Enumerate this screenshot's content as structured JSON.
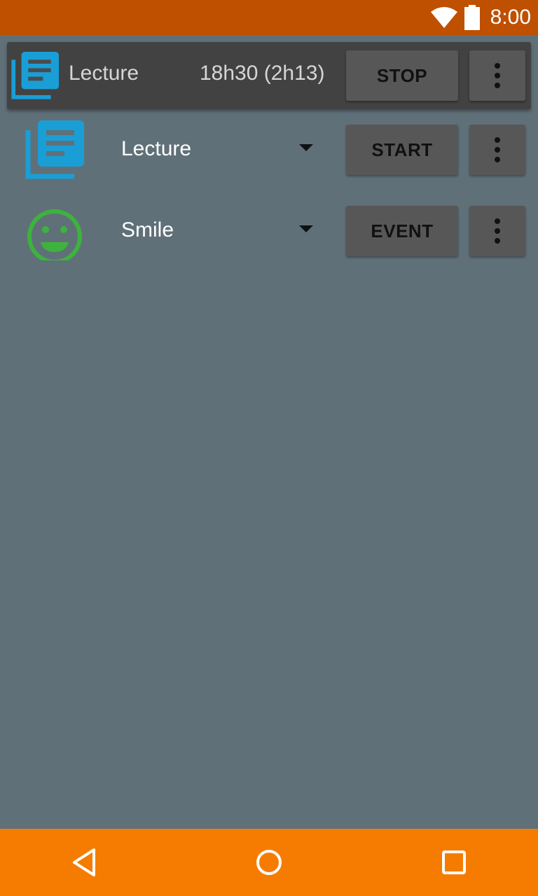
{
  "status_bar": {
    "time": "8:00",
    "icons": [
      "wifi-icon",
      "battery-icon"
    ]
  },
  "active": {
    "icon": "document-stack-icon",
    "name": "Lecture",
    "time": "18h30 (2h13)",
    "stop_label": "STOP",
    "more_icon": "more-vert-icon"
  },
  "rows": [
    {
      "icon": "document-stack-icon",
      "label": "Lecture",
      "action_label": "START",
      "dropdown_icon": "caret-down-icon",
      "more_icon": "more-vert-icon"
    },
    {
      "icon": "smiley-icon",
      "label": "Smile",
      "action_label": "EVENT",
      "dropdown_icon": "caret-down-icon",
      "more_icon": "more-vert-icon"
    }
  ],
  "nav": {
    "icons": [
      "back-icon",
      "home-icon",
      "recents-icon"
    ]
  },
  "colors": {
    "status_bar": "#bf5000",
    "nav_bar": "#f57c00",
    "background": "#607079",
    "active_row": "#424242",
    "button": "#575757",
    "lecture_icon": "#1a9ed6",
    "smile_icon": "#3db33d"
  }
}
